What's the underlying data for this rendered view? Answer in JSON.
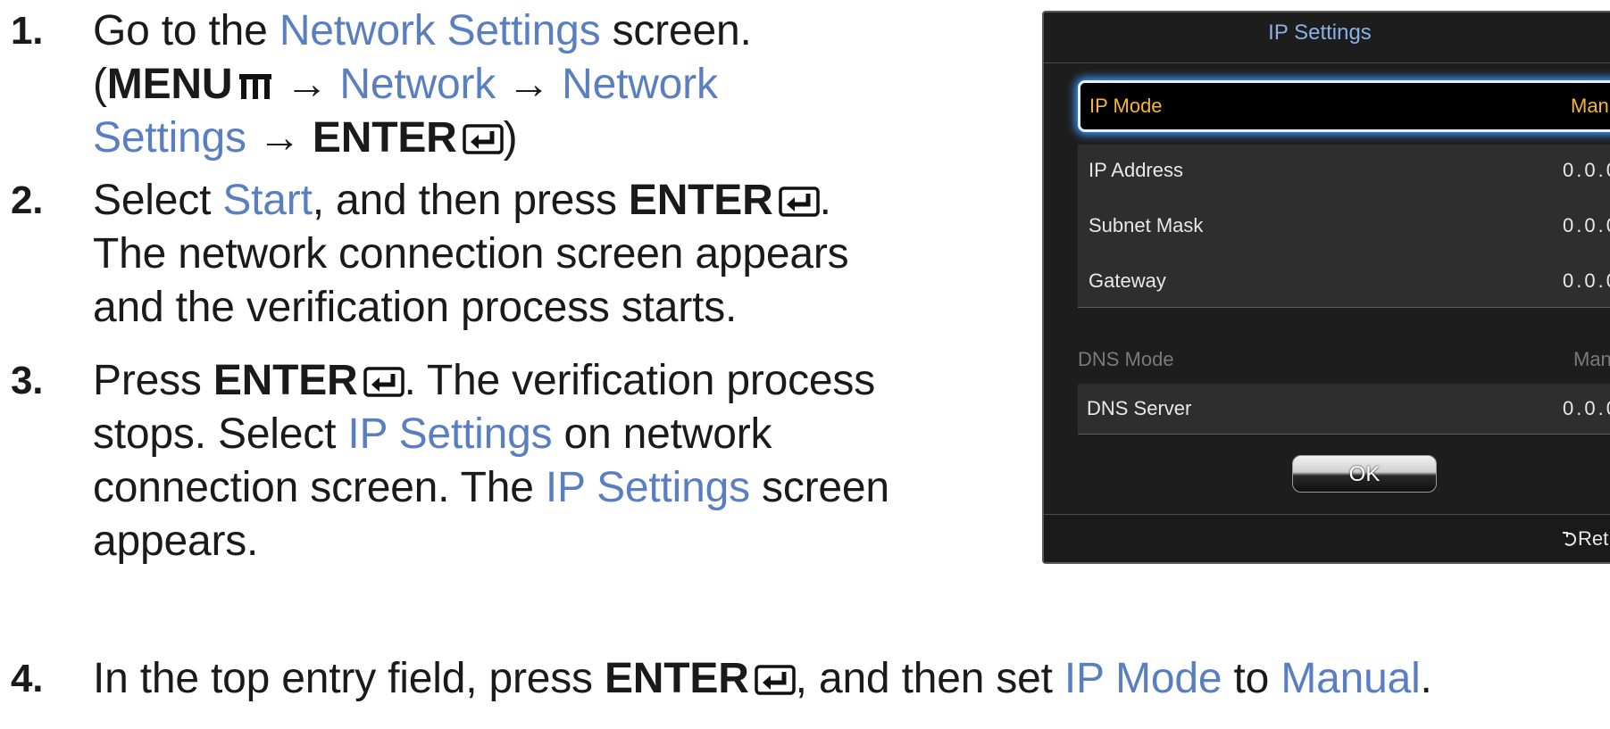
{
  "steps": [
    {
      "num": "1.",
      "lines": [
        [
          {
            "t": "Go to the "
          },
          {
            "t": "Network Settings",
            "c": "blue"
          },
          {
            "t": " screen."
          }
        ],
        [
          {
            "t": "("
          },
          {
            "t": "MENU",
            "c": "b"
          },
          {
            "icon": "menu"
          },
          {
            "t": " → "
          },
          {
            "t": "Network",
            "c": "blue"
          },
          {
            "t": " → "
          },
          {
            "t": "Network",
            "c": "blue"
          }
        ],
        [
          {
            "t": "Settings",
            "c": "blue"
          },
          {
            "t": " → "
          },
          {
            "t": "ENTER",
            "c": "b"
          },
          {
            "icon": "enter"
          },
          {
            "t": ")"
          }
        ]
      ]
    },
    {
      "num": "2.",
      "lines": [
        [
          {
            "t": "Select "
          },
          {
            "t": "Start",
            "c": "blue"
          },
          {
            "t": ", and then press "
          },
          {
            "t": "ENTER",
            "c": "b"
          },
          {
            "icon": "enter"
          },
          {
            "t": "."
          }
        ],
        [
          {
            "t": "The network connection screen appears"
          }
        ],
        [
          {
            "t": "and the verification process starts."
          }
        ]
      ]
    },
    {
      "num": "3.",
      "lines": [
        [
          {
            "t": "Press "
          },
          {
            "t": "ENTER",
            "c": "b"
          },
          {
            "icon": "enter"
          },
          {
            "t": ". The verification process"
          }
        ],
        [
          {
            "t": "stops. Select "
          },
          {
            "t": "IP Settings",
            "c": "blue"
          },
          {
            "t": " on network"
          }
        ],
        [
          {
            "t": "connection screen. The "
          },
          {
            "t": "IP Settings",
            "c": "blue"
          },
          {
            "t": " screen"
          }
        ],
        [
          {
            "t": "appears."
          }
        ]
      ]
    },
    {
      "num": "4.",
      "lines": [
        [
          {
            "t": "In the top entry field, press "
          },
          {
            "t": "ENTER",
            "c": "b"
          },
          {
            "icon": "enter"
          },
          {
            "t": ", and then set "
          },
          {
            "t": "IP Mode",
            "c": "blue"
          },
          {
            "t": " to "
          },
          {
            "t": "Manual",
            "c": "blue"
          },
          {
            "t": "."
          }
        ]
      ]
    }
  ],
  "dialog": {
    "title": "IP Settings",
    "ip_mode_label": "IP Mode",
    "ip_mode_value": "Man",
    "ip_address_label": "IP Address",
    "ip_address_value": "0.0.0",
    "subnet_mask_label": "Subnet Mask",
    "subnet_mask_value": "0.0.0",
    "gateway_label": "Gateway",
    "gateway_value": "0.0.0",
    "dns_mode_label": "DNS Mode",
    "dns_mode_value": "Man",
    "dns_server_label": "DNS Server",
    "dns_server_value": "0.0.0",
    "ok_label": "OK",
    "return_label": "Ret"
  },
  "colors": {
    "accent_blue": "#5a7fc0",
    "selected_text": "#f6b43a",
    "title_blue": "#8ab0e6"
  }
}
